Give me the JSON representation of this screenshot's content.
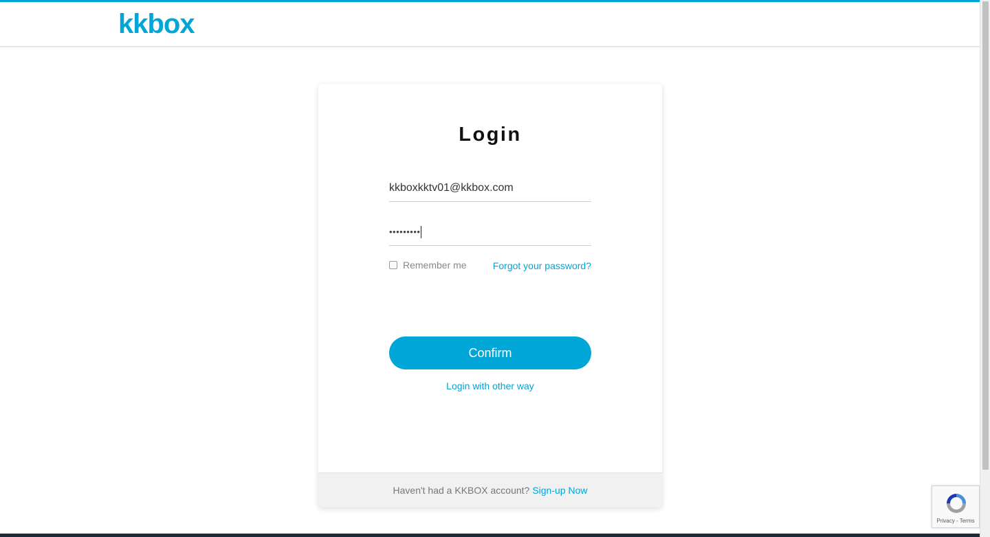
{
  "header": {
    "logo_text": "kkbox"
  },
  "login_card": {
    "title": "Login",
    "email_value": "kkboxkktv01@kkbox.com",
    "password_masked": "•••••••••",
    "remember_label": "Remember me",
    "forgot_label": "Forgot your password?",
    "confirm_label": "Confirm",
    "other_way_label": "Login with other way",
    "footer_text": "Haven't had a KKBOX account?",
    "signup_label": "Sign-up Now"
  },
  "recaptcha": {
    "privacy": "Privacy",
    "separator": " - ",
    "terms": "Terms"
  },
  "colors": {
    "accent": "#00a6d6",
    "footer_bar": "#1c2b3a"
  }
}
